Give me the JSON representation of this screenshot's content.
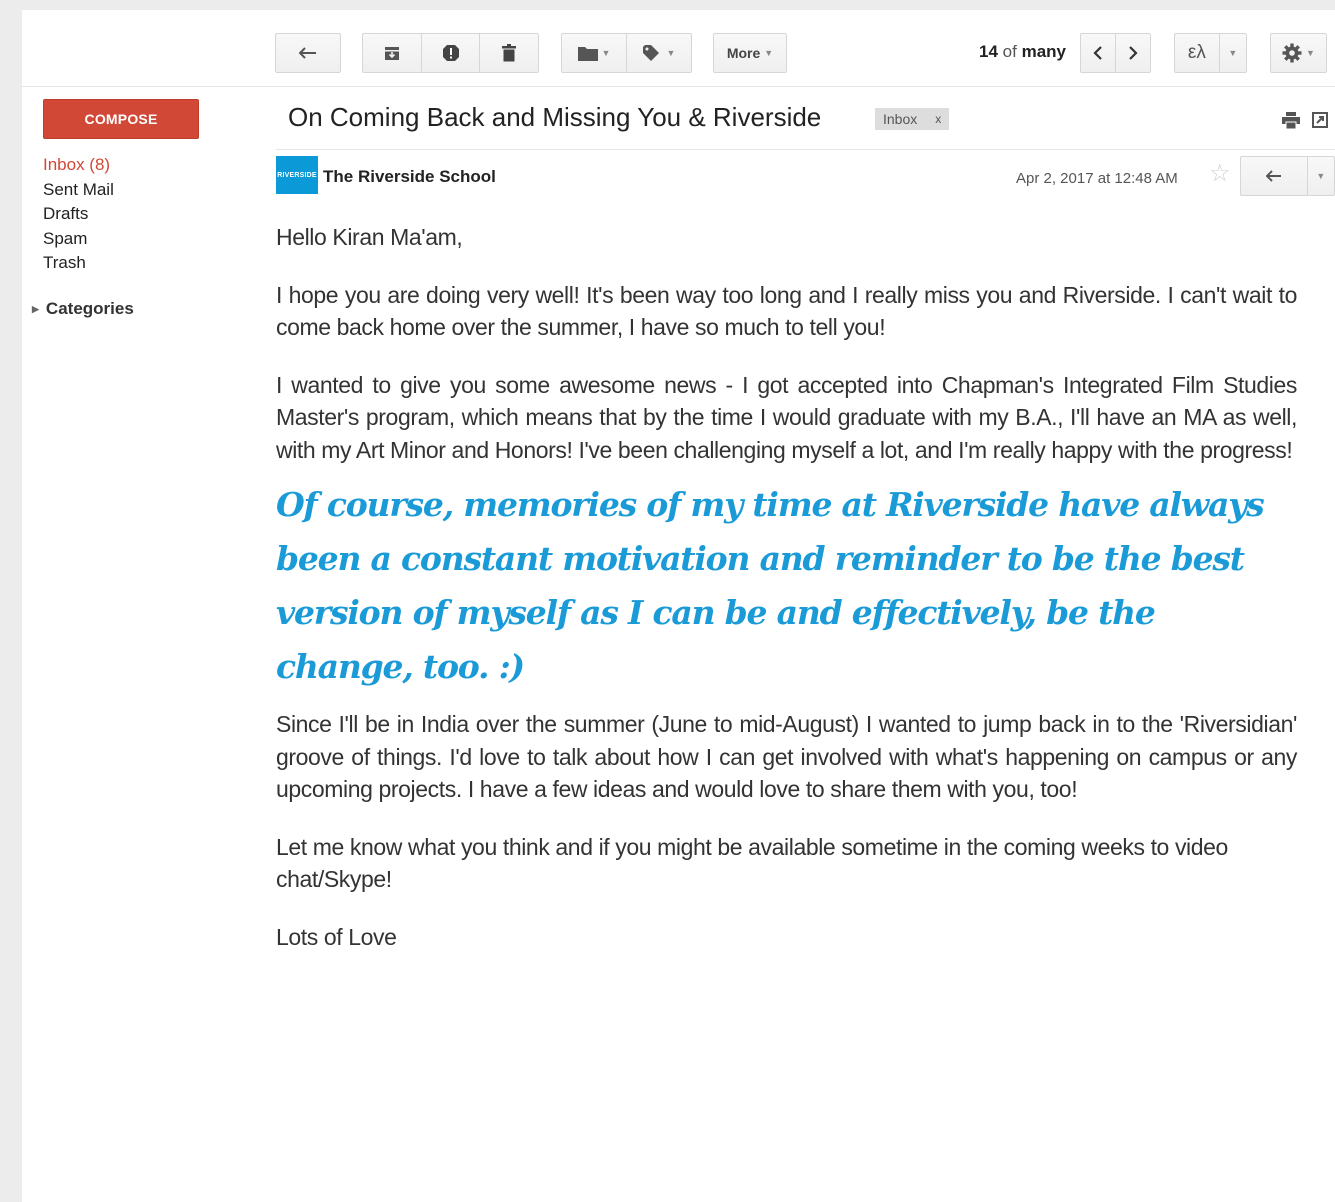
{
  "toolbar": {
    "more_label": "More",
    "pager_current": "14",
    "pager_of": "of",
    "pager_total": "many",
    "lang_label": "ελ"
  },
  "sidebar": {
    "compose_label": "COMPOSE",
    "items": [
      {
        "label": "Inbox (8)",
        "active": true
      },
      {
        "label": "Sent Mail"
      },
      {
        "label": "Drafts"
      },
      {
        "label": "Spam"
      },
      {
        "label": "Trash"
      }
    ],
    "categories_label": "Categories"
  },
  "message": {
    "subject": "On Coming Back and Missing You & Riverside",
    "label": "Inbox",
    "label_remove": "x",
    "sender": "The Riverside School",
    "avatar_text": "RIVERSIDE",
    "date": "Apr 2, 2017 at 12:48 AM",
    "greeting": "Hello Kiran Ma'am,",
    "p1": "I hope you are doing very well! It's been way too long and I really miss you and Riverside. I can't wait to come back home over the summer, I have so much to tell you!",
    "p2": "I wanted to give you some awesome news - I got accepted into Chapman's Integrated Film Studies Master's program, which means that by the time I would graduate with my B.A., I'll have an MA as well, with my Art Minor and Honors! I've been challenging myself a lot, and I'm really happy with the progress!",
    "quote": "Of course, memories of my time at Riverside have always been a constant motivation and reminder to be the best version of myself as I can be and effectively, be the change, too. :)",
    "p3": "Since I'll be in India over the summer (June to mid-August) I wanted to jump back in to the 'Riversidian' groove of things. I'd love to talk about how I can get involved with what's happening on campus or any upcoming projects. I have a few ideas and would love to share them with you, too!",
    "p4": "Let me know what you think and if you might be available sometime in the coming weeks to video chat/Skype!",
    "signoff": "Lots of Love"
  },
  "colors": {
    "accent_red": "#d14836",
    "quote_blue": "#1a9bd7"
  }
}
